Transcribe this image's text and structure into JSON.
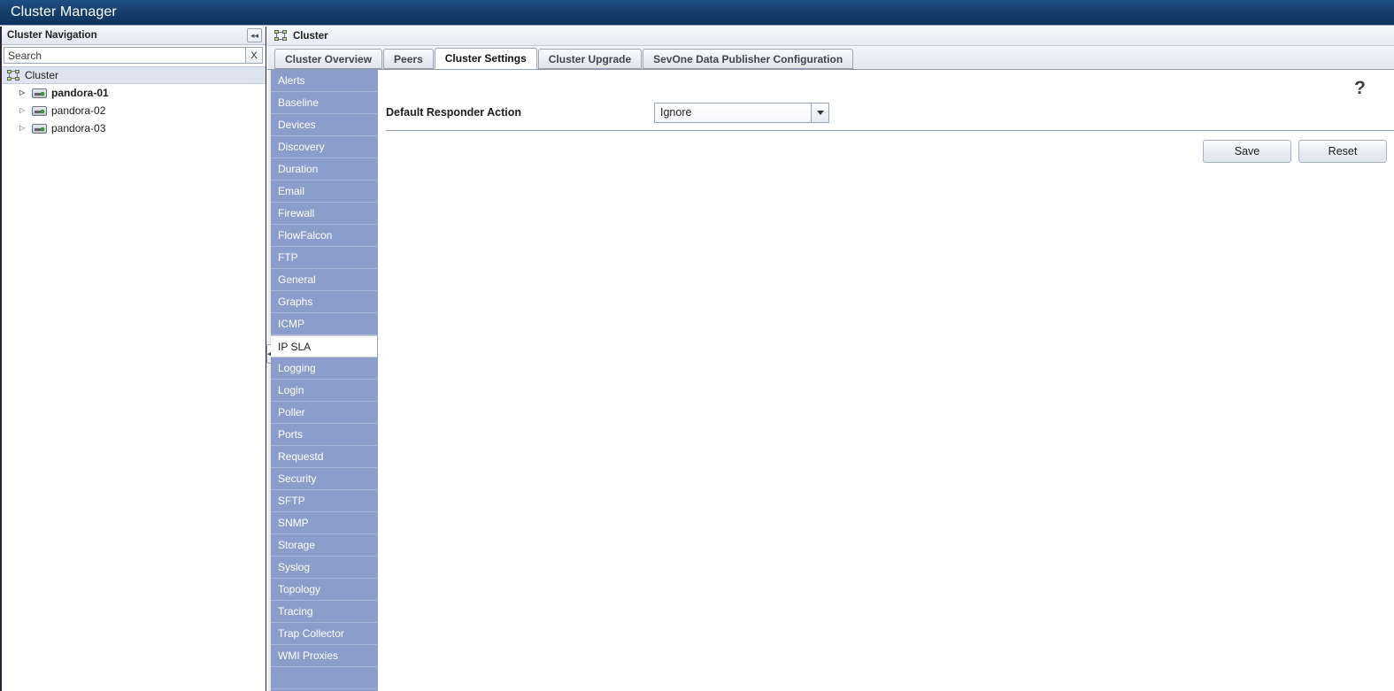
{
  "window": {
    "title": "Cluster Manager"
  },
  "navigation": {
    "header_title": "Cluster Navigation",
    "collapse_icon": "collapse-left-icon",
    "search": {
      "placeholder": "Search",
      "value": "",
      "clear_label": "X"
    },
    "tree": {
      "root": {
        "label": "Cluster",
        "icon": "cluster-icon"
      },
      "children": [
        {
          "label": "pandora-01",
          "icon": "server-icon",
          "bold": true,
          "twisty": "▷"
        },
        {
          "label": "pandora-02",
          "icon": "server-icon",
          "bold": false,
          "twisty": "▷"
        },
        {
          "label": "pandora-03",
          "icon": "server-icon",
          "bold": false,
          "twisty": "▷"
        }
      ]
    }
  },
  "panel": {
    "header_title": "Cluster",
    "header_icon": "cluster-icon",
    "tabs": [
      {
        "label": "Cluster Overview",
        "active": false
      },
      {
        "label": "Peers",
        "active": false
      },
      {
        "label": "Cluster Settings",
        "active": true
      },
      {
        "label": "Cluster Upgrade",
        "active": false
      },
      {
        "label": "SevOne Data Publisher Configuration",
        "active": false
      }
    ]
  },
  "settings_menu": {
    "selected": "IP SLA",
    "items": [
      "Alerts",
      "Baseline",
      "Devices",
      "Discovery",
      "Duration",
      "Email",
      "Firewall",
      "FlowFalcon",
      "FTP",
      "General",
      "Graphs",
      "ICMP",
      "IP SLA",
      "Logging",
      "Login",
      "Poller",
      "Ports",
      "Requestd",
      "Security",
      "SFTP",
      "SNMP",
      "Storage",
      "Syslog",
      "Topology",
      "Tracing",
      "Trap Collector",
      "WMI Proxies",
      ""
    ]
  },
  "form": {
    "help_label": "?",
    "fields": [
      {
        "label": "Default Responder Action",
        "type": "select",
        "value": "Ignore",
        "options": [
          "Ignore"
        ]
      }
    ],
    "buttons": [
      {
        "label": "Save",
        "name": "save-button"
      },
      {
        "label": "Reset",
        "name": "reset-button"
      }
    ]
  },
  "splitter": {
    "collapse_icon": "chevron-left-icon",
    "glyph": "◀"
  }
}
